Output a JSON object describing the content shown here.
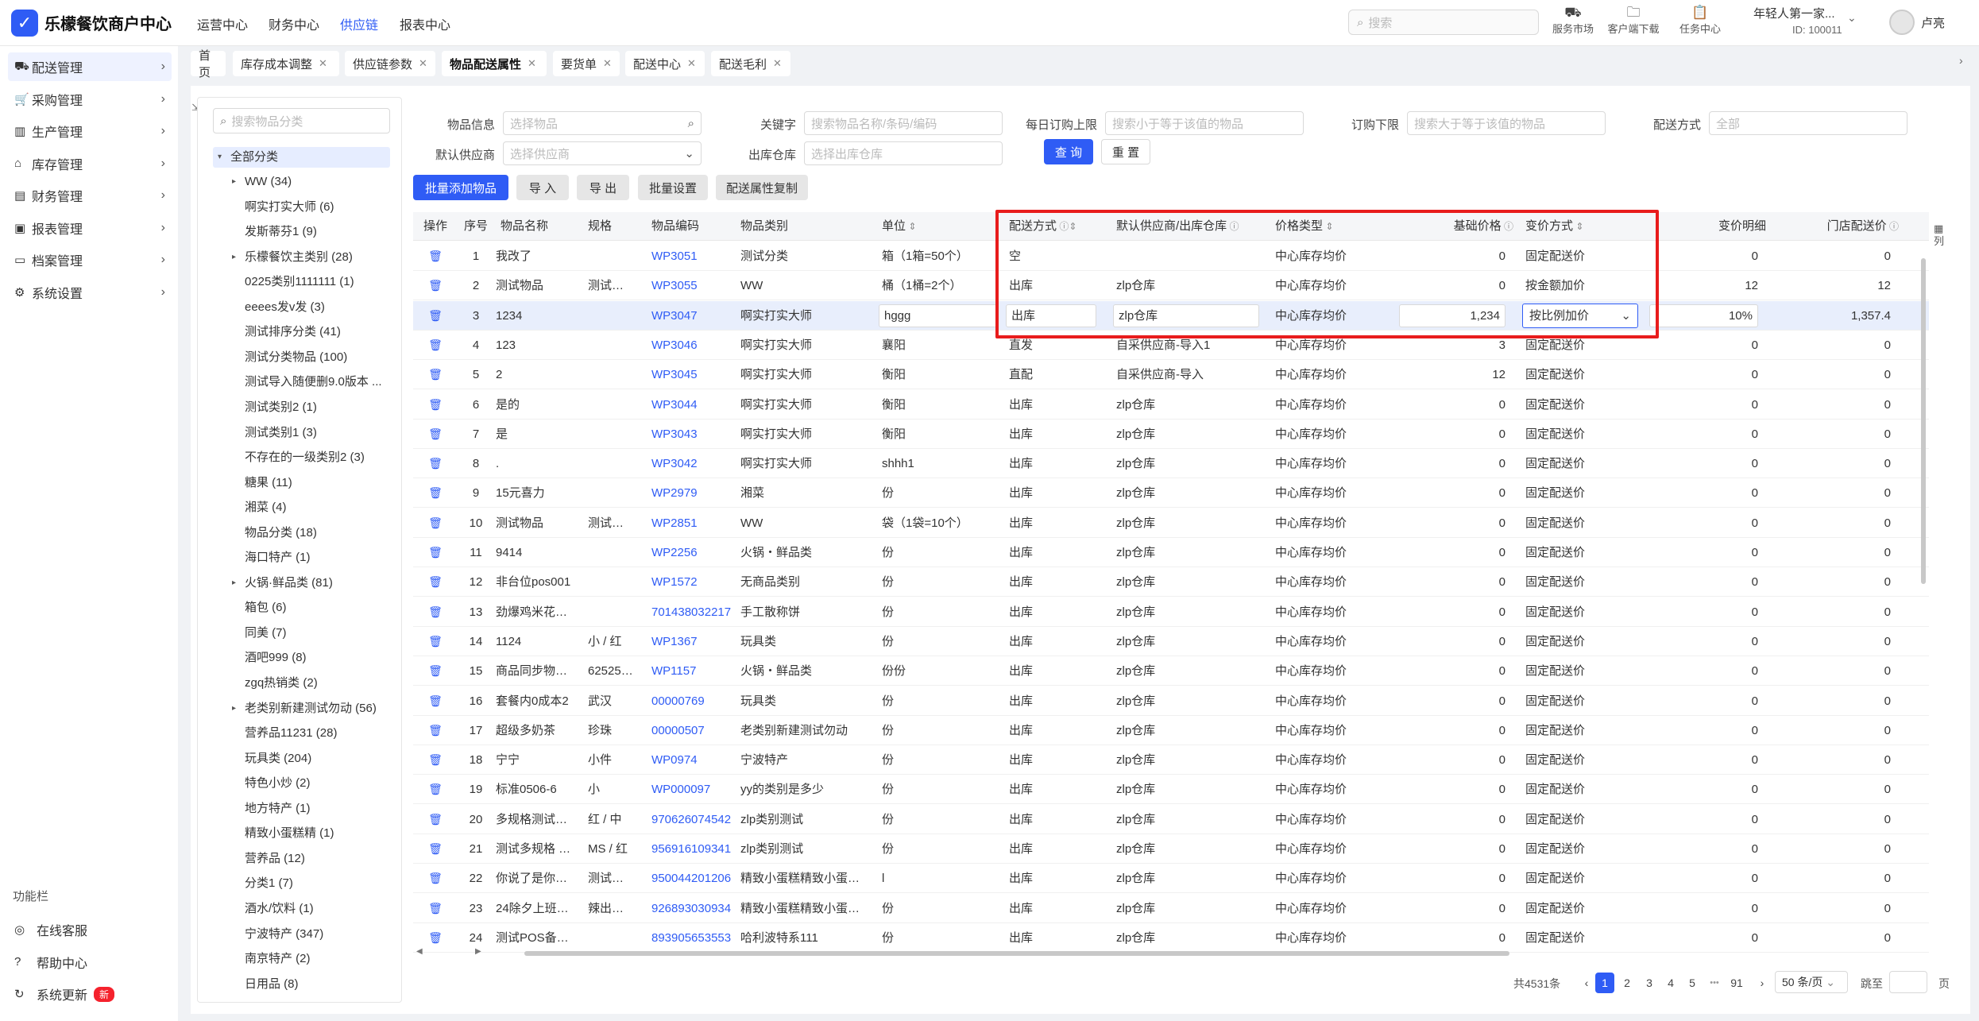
{
  "app": {
    "name": "乐檬餐饮商户中心"
  },
  "topnav": [
    "运营中心",
    "财务中心",
    "供应链",
    "报表中心"
  ],
  "topnav_active": "供应链",
  "search_placeholder": "搜索",
  "tools": [
    {
      "label": "服务市场",
      "icon": "bag-icon"
    },
    {
      "label": "客户端下载",
      "icon": "folder-icon"
    },
    {
      "label": "任务中心",
      "icon": "clipboard-icon"
    }
  ],
  "store": {
    "name": "年轻人第一家...",
    "id": "ID: 100011"
  },
  "user": {
    "name": "卢亮"
  },
  "sidebar": {
    "items": [
      {
        "label": "配送管理",
        "icon": "truck-icon",
        "active": true
      },
      {
        "label": "采购管理",
        "icon": "cart-icon"
      },
      {
        "label": "生产管理",
        "icon": "factory-icon"
      },
      {
        "label": "库存管理",
        "icon": "warehouse-icon"
      },
      {
        "label": "财务管理",
        "icon": "wallet-icon"
      },
      {
        "label": "报表管理",
        "icon": "report-icon"
      },
      {
        "label": "档案管理",
        "icon": "archive-icon"
      },
      {
        "label": "系统设置",
        "icon": "gear-icon"
      }
    ],
    "function_title": "功能栏",
    "functions": [
      {
        "label": "在线客服",
        "icon": "headset-icon"
      },
      {
        "label": "帮助中心",
        "icon": "help-icon"
      },
      {
        "label": "系统更新",
        "icon": "refresh-icon",
        "badge": "新"
      }
    ]
  },
  "tabs": [
    {
      "label": "首页",
      "closable": false
    },
    {
      "label": "库存成本调整",
      "closable": true
    },
    {
      "label": "供应链参数",
      "closable": true
    },
    {
      "label": "物品配送属性",
      "closable": true,
      "active": true
    },
    {
      "label": "要货单",
      "closable": true
    },
    {
      "label": "配送中心",
      "closable": true
    },
    {
      "label": "配送毛利",
      "closable": true
    }
  ],
  "tree": {
    "search_placeholder": "搜索物品分类",
    "root": "全部分类",
    "nodes": [
      {
        "label": "WW (34)",
        "caret": true
      },
      {
        "label": "啊实打实大师 (6)"
      },
      {
        "label": "发斯蒂芬1 (9)"
      },
      {
        "label": "乐檬餐饮主类别 (28)",
        "caret": true
      },
      {
        "label": "0225类别1111111 (1)"
      },
      {
        "label": "eeees发v发 (3)"
      },
      {
        "label": "测试排序分类 (41)"
      },
      {
        "label": "测试分类物品 (100)"
      },
      {
        "label": "测试导入随便删9.0版本 ..."
      },
      {
        "label": "测试类别2 (1)"
      },
      {
        "label": "测试类别1 (3)"
      },
      {
        "label": "不存在的一级类别2 (3)"
      },
      {
        "label": "糖果 (11)"
      },
      {
        "label": "湘菜 (4)"
      },
      {
        "label": "物品分类 (18)"
      },
      {
        "label": "海口特产 (1)"
      },
      {
        "label": "火锅·鲜品类 (81)",
        "caret": true
      },
      {
        "label": "箱包 (6)"
      },
      {
        "label": "同美 (7)"
      },
      {
        "label": "酒吧999 (8)"
      },
      {
        "label": "zgq热销类 (2)"
      },
      {
        "label": "老类别新建测试勿动 (56)",
        "caret": true
      },
      {
        "label": "营养品11231 (28)"
      },
      {
        "label": "玩具类 (204)"
      },
      {
        "label": "特色小炒 (2)"
      },
      {
        "label": "地方特产 (1)"
      },
      {
        "label": "精致小蛋糕精 (1)"
      },
      {
        "label": "营养品 (12)"
      },
      {
        "label": "分类1 (7)"
      },
      {
        "label": "酒水/饮料 (1)"
      },
      {
        "label": "宁波特产 (347)"
      },
      {
        "label": "南京特产 (2)"
      },
      {
        "label": "日用品 (8)"
      }
    ]
  },
  "filters": {
    "item_info": {
      "label": "物品信息",
      "placeholder": "选择物品"
    },
    "keyword": {
      "label": "关键字",
      "placeholder": "搜索物品名称/条码/编码"
    },
    "daily_max": {
      "label": "每日订购上限",
      "placeholder": "搜索小于等于该值的物品"
    },
    "order_min": {
      "label": "订购下限",
      "placeholder": "搜索大于等于该值的物品"
    },
    "delivery_method": {
      "label": "配送方式",
      "placeholder": "全部"
    },
    "supplier": {
      "label": "默认供应商",
      "placeholder": "选择供应商"
    },
    "warehouse": {
      "label": "出库仓库",
      "placeholder": "选择出库仓库"
    },
    "query": "查 询",
    "reset": "重 置"
  },
  "actions": {
    "batch_add": "批量添加物品",
    "import": "导 入",
    "export": "导 出",
    "batch_set": "批量设置",
    "copy": "配送属性复制"
  },
  "table": {
    "headers": {
      "op": "操作",
      "seq": "序号",
      "name": "物品名称",
      "spec": "规格",
      "code": "物品编码",
      "category": "物品类别",
      "unit": "单位",
      "method": "配送方式",
      "supplier": "默认供应商/出库仓库",
      "price_type": "价格类型",
      "base_price": "基础价格",
      "markup": "变价方式",
      "markup_detail": "变价明细",
      "store_price": "门店配送价",
      "col_settings": "列"
    },
    "rows": [
      {
        "seq": "1",
        "name": "我改了",
        "spec": "",
        "code": "WP3051",
        "category": "测试分类",
        "unit": "箱（1箱=50个）",
        "method": "空",
        "supplier": "",
        "price_type": "中心库存均价",
        "base_price": "0",
        "markup": "固定配送价",
        "detail": "0",
        "store_price": "0"
      },
      {
        "seq": "2",
        "name": "测试物品",
        "spec": "测试…",
        "code": "WP3055",
        "category": "WW",
        "unit": "桶（1桶=2个）",
        "method": "出库",
        "supplier": "zlp仓库",
        "price_type": "中心库存均价",
        "base_price": "0",
        "markup": "按金额加价",
        "detail": "12",
        "store_price": "12"
      },
      {
        "seq": "3",
        "name": "1234",
        "spec": "",
        "code": "WP3047",
        "category": "啊实打实大师",
        "unit": "hggg",
        "method": "出库",
        "supplier": "zlp仓库",
        "price_type": "中心库存均价",
        "base_price": "1,234",
        "markup": "按比例加价",
        "detail": "10%",
        "store_price": "1,357.4",
        "editing": true
      },
      {
        "seq": "4",
        "name": "123",
        "spec": "",
        "code": "WP3046",
        "category": "啊实打实大师",
        "unit": "襄阳",
        "method": "直发",
        "supplier": "自采供应商-导入1",
        "price_type": "中心库存均价",
        "base_price": "3",
        "markup": "固定配送价",
        "detail": "0",
        "store_price": "0"
      },
      {
        "seq": "5",
        "name": "2",
        "spec": "",
        "code": "WP3045",
        "category": "啊实打实大师",
        "unit": "衡阳",
        "method": "直配",
        "supplier": "自采供应商-导入",
        "price_type": "中心库存均价",
        "base_price": "12",
        "markup": "固定配送价",
        "detail": "0",
        "store_price": "0"
      },
      {
        "seq": "6",
        "name": "是的",
        "spec": "",
        "code": "WP3044",
        "category": "啊实打实大师",
        "unit": "衡阳",
        "method": "出库",
        "supplier": "zlp仓库",
        "price_type": "中心库存均价",
        "base_price": "0",
        "markup": "固定配送价",
        "detail": "0",
        "store_price": "0"
      },
      {
        "seq": "7",
        "name": "是",
        "spec": "",
        "code": "WP3043",
        "category": "啊实打实大师",
        "unit": "衡阳",
        "method": "出库",
        "supplier": "zlp仓库",
        "price_type": "中心库存均价",
        "base_price": "0",
        "markup": "固定配送价",
        "detail": "0",
        "store_price": "0"
      },
      {
        "seq": "8",
        "name": ".",
        "spec": "",
        "code": "WP3042",
        "category": "啊实打实大师",
        "unit": "shhh1",
        "method": "出库",
        "supplier": "zlp仓库",
        "price_type": "中心库存均价",
        "base_price": "0",
        "markup": "固定配送价",
        "detail": "0",
        "store_price": "0"
      },
      {
        "seq": "9",
        "name": "15元喜力",
        "spec": "",
        "code": "WP2979",
        "category": "湘菜",
        "unit": "份",
        "method": "出库",
        "supplier": "zlp仓库",
        "price_type": "中心库存均价",
        "base_price": "0",
        "markup": "固定配送价",
        "detail": "0",
        "store_price": "0"
      },
      {
        "seq": "10",
        "name": "测试物品",
        "spec": "测试…",
        "code": "WP2851",
        "category": "WW",
        "unit": "袋（1袋=10个）",
        "method": "出库",
        "supplier": "zlp仓库",
        "price_type": "中心库存均价",
        "base_price": "0",
        "markup": "固定配送价",
        "detail": "0",
        "store_price": "0"
      },
      {
        "seq": "11",
        "name": "9414",
        "spec": "",
        "code": "WP2256",
        "category": "火锅・鲜品类",
        "unit": "份",
        "method": "出库",
        "supplier": "zlp仓库",
        "price_type": "中心库存均价",
        "base_price": "0",
        "markup": "固定配送价",
        "detail": "0",
        "store_price": "0"
      },
      {
        "seq": "12",
        "name": "非台位pos001",
        "spec": "",
        "code": "WP1572",
        "category": "无商品类别",
        "unit": "份",
        "method": "出库",
        "supplier": "zlp仓库",
        "price_type": "中心库存均价",
        "base_price": "0",
        "markup": "固定配送价",
        "detail": "0",
        "store_price": "0"
      },
      {
        "seq": "13",
        "name": "劲爆鸡米花…",
        "spec": "",
        "code": "701438032217",
        "category": "手工散称饼",
        "unit": "份",
        "method": "出库",
        "supplier": "zlp仓库",
        "price_type": "中心库存均价",
        "base_price": "0",
        "markup": "固定配送价",
        "detail": "0",
        "store_price": "0"
      },
      {
        "seq": "14",
        "name": "1124",
        "spec": "小 / 红",
        "code": "WP1367",
        "category": "玩具类",
        "unit": "份",
        "method": "出库",
        "supplier": "zlp仓库",
        "price_type": "中心库存均价",
        "base_price": "0",
        "markup": "固定配送价",
        "detail": "0",
        "store_price": "0"
      },
      {
        "seq": "15",
        "name": "商品同步物…",
        "spec": "62525…",
        "code": "WP1157",
        "category": "火锅・鲜品类",
        "unit": "份份",
        "method": "出库",
        "supplier": "zlp仓库",
        "price_type": "中心库存均价",
        "base_price": "0",
        "markup": "固定配送价",
        "detail": "0",
        "store_price": "0"
      },
      {
        "seq": "16",
        "name": "套餐内0成本2",
        "spec": "武汉",
        "code": "00000769",
        "category": "玩具类",
        "unit": "份",
        "method": "出库",
        "supplier": "zlp仓库",
        "price_type": "中心库存均价",
        "base_price": "0",
        "markup": "固定配送价",
        "detail": "0",
        "store_price": "0"
      },
      {
        "seq": "17",
        "name": "超级多奶茶",
        "spec": "珍珠",
        "code": "00000507",
        "category": "老类别新建测试勿动",
        "unit": "份",
        "method": "出库",
        "supplier": "zlp仓库",
        "price_type": "中心库存均价",
        "base_price": "0",
        "markup": "固定配送价",
        "detail": "0",
        "store_price": "0"
      },
      {
        "seq": "18",
        "name": "宁宁",
        "spec": "小件",
        "code": "WP0974",
        "category": "宁波特产",
        "unit": "份",
        "method": "出库",
        "supplier": "zlp仓库",
        "price_type": "中心库存均价",
        "base_price": "0",
        "markup": "固定配送价",
        "detail": "0",
        "store_price": "0"
      },
      {
        "seq": "19",
        "name": "标准0506-6",
        "spec": "小",
        "code": "WP000097",
        "category": "yy的类别是多少",
        "unit": "份",
        "method": "出库",
        "supplier": "zlp仓库",
        "price_type": "中心库存均价",
        "base_price": "0",
        "markup": "固定配送价",
        "detail": "0",
        "store_price": "0"
      },
      {
        "seq": "20",
        "name": "多规格测试…",
        "spec": "红 / 中",
        "code": "970626074542",
        "category": "zlp类别测试",
        "unit": "份",
        "method": "出库",
        "supplier": "zlp仓库",
        "price_type": "中心库存均价",
        "base_price": "0",
        "markup": "固定配送价",
        "detail": "0",
        "store_price": "0"
      },
      {
        "seq": "21",
        "name": "测试多规格 …",
        "spec": "MS / 红",
        "code": "956916109341",
        "category": "zlp类别测试",
        "unit": "份",
        "method": "出库",
        "supplier": "zlp仓库",
        "price_type": "中心库存均价",
        "base_price": "0",
        "markup": "固定配送价",
        "detail": "0",
        "store_price": "0"
      },
      {
        "seq": "22",
        "name": "你说了是你…",
        "spec": "测试…",
        "code": "950044201206",
        "category": "精致小蛋糕精致小蛋…",
        "unit": "l",
        "method": "出库",
        "supplier": "zlp仓库",
        "price_type": "中心库存均价",
        "base_price": "0",
        "markup": "固定配送价",
        "detail": "0",
        "store_price": "0"
      },
      {
        "seq": "23",
        "name": "24除夕上班…",
        "spec": "辣出…",
        "code": "926893030934",
        "category": "精致小蛋糕精致小蛋…",
        "unit": "份",
        "method": "出库",
        "supplier": "zlp仓库",
        "price_type": "中心库存均价",
        "base_price": "0",
        "markup": "固定配送价",
        "detail": "0",
        "store_price": "0"
      },
      {
        "seq": "24",
        "name": "测试POS备…",
        "spec": "",
        "code": "893905653553",
        "category": "哈利波特系111",
        "unit": "份",
        "method": "出库",
        "supplier": "zlp仓库",
        "price_type": "中心库存均价",
        "base_price": "0",
        "markup": "固定配送价",
        "detail": "0",
        "store_price": "0"
      }
    ]
  },
  "pagination": {
    "total": "共4531条",
    "pages": [
      "1",
      "2",
      "3",
      "4",
      "5",
      "91"
    ],
    "ellipsis": "•••",
    "page_size": "50 条/页",
    "jump_label": "跳至",
    "page_suffix": "页"
  },
  "colors": {
    "primary": "#2f5cf5",
    "highlight_box": "#e81c1c"
  }
}
